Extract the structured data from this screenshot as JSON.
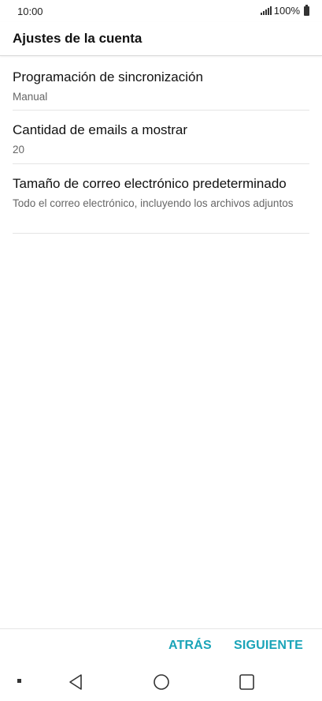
{
  "status_bar": {
    "time": "10:00",
    "battery": "100%"
  },
  "header": {
    "title": "Ajustes de la cuenta"
  },
  "settings": [
    {
      "title": "Programación de sincronización",
      "summary": "Manual"
    },
    {
      "title": "Cantidad de emails a mostrar",
      "summary": "20"
    },
    {
      "title": "Tamaño de correo electrónico predeterminado",
      "summary": "Todo el correo electrónico, incluyendo los archivos adjuntos"
    }
  ],
  "actions": {
    "back_label": "ATRÁS",
    "next_label": "SIGUIENTE"
  },
  "colors": {
    "accent": "#1aa4b8"
  },
  "icons": [
    "signal-icon",
    "battery-icon",
    "nav-back-icon",
    "nav-home-icon",
    "nav-recent-icon"
  ]
}
